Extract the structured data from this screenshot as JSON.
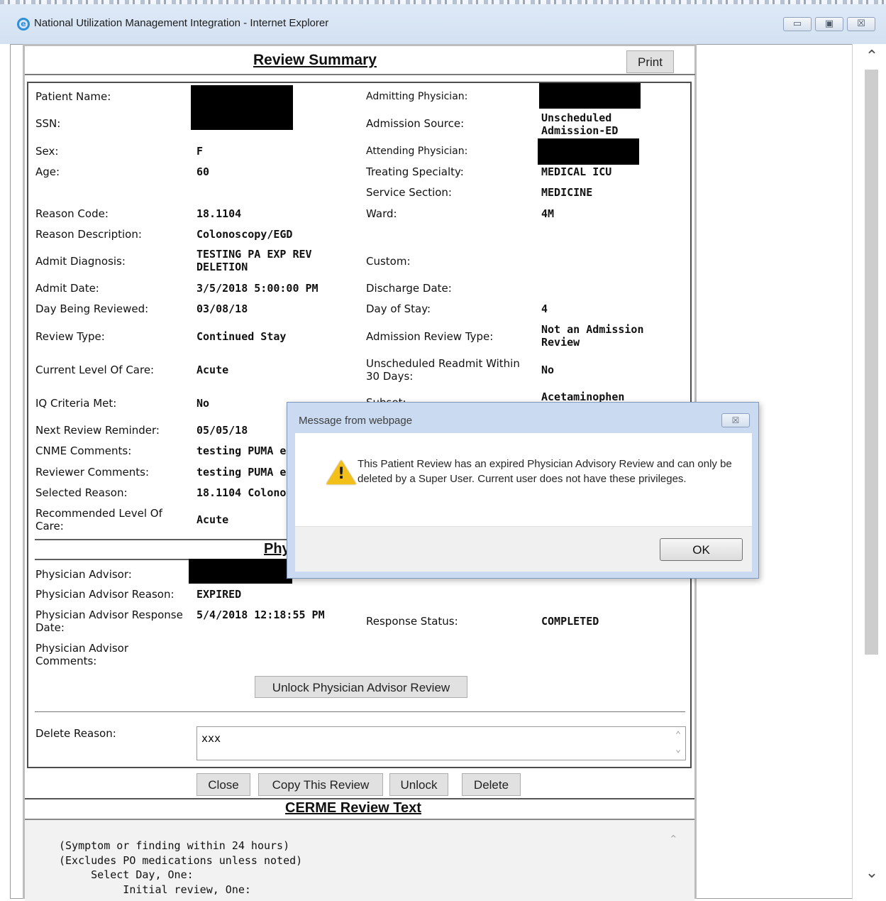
{
  "window": {
    "title": "National Utilization Management Integration - Internet Explorer",
    "minimize_symbol": "▭",
    "maximize_symbol": "▣",
    "close_symbol": "☒"
  },
  "summary": {
    "title": "Review Summary",
    "print_label": "Print"
  },
  "details": {
    "patient_name_label": "Patient Name:",
    "ssn_label": "SSN:",
    "sex_label": "Sex:",
    "sex_value": "F",
    "age_label": "Age:",
    "age_value": "60",
    "reason_code_label": "Reason Code:",
    "reason_code_value": "18.1104",
    "reason_description_label": "Reason Description:",
    "reason_description_value": "Colonoscopy/EGD",
    "admit_diagnosis_label": "Admit Diagnosis:",
    "admit_diagnosis_value": "TESTING PA EXP REV DELETION",
    "admit_date_label": "Admit Date:",
    "admit_date_value": "3/5/2018 5:00:00 PM",
    "day_being_reviewed_label": "Day Being Reviewed:",
    "day_being_reviewed_value": "03/08/18",
    "review_type_label": "Review Type:",
    "review_type_value": "Continued Stay",
    "current_level_label": "Current Level Of Care:",
    "current_level_value": "Acute",
    "iq_criteria_label": "IQ Criteria Met:",
    "iq_criteria_value": "No",
    "next_review_label": "Next Review Reminder:",
    "next_review_value": "05/05/18",
    "cnme_comments_label": "CNME Comments:",
    "cnme_comments_value": "testing PUMA e:",
    "reviewer_comments_label": "Reviewer Comments:",
    "reviewer_comments_value": "testing PUMA e:",
    "selected_reason_label": "Selected Reason:",
    "selected_reason_value": "18.1104 Colono",
    "recommended_level_label": "Recommended Level Of Care:",
    "recommended_level_value": "Acute",
    "admitting_physician_label": "Admitting Physician:",
    "admission_source_label": "Admission Source:",
    "admission_source_value": "Unscheduled Admission-ED",
    "attending_physician_label": "Attending Physician:",
    "treating_specialty_label": "Treating Specialty:",
    "treating_specialty_value": "MEDICAL ICU",
    "service_section_label": "Service Section:",
    "service_section_value": "MEDICINE",
    "ward_label": "Ward:",
    "ward_value": "4M",
    "custom_label": "Custom:",
    "discharge_date_label": "Discharge Date:",
    "day_of_stay_label": "Day of Stay:",
    "day_of_stay_value": "4",
    "admission_review_type_label": "Admission Review Type:",
    "admission_review_type_value": "Not an Admission Review",
    "readmit_label": "Unscheduled Readmit Within 30 Days:",
    "readmit_value": "No",
    "subset_label": "Subset:",
    "subset_value": "Acetaminophen"
  },
  "physician_section": {
    "title_partial": "Phy",
    "advisor_label": "Physician Advisor:",
    "advisor_reason_label": "Physician Advisor Reason:",
    "advisor_reason_value": "EXPIRED",
    "response_date_label": "Physician Advisor Response Date:",
    "response_date_value": "5/4/2018 12:18:55 PM",
    "response_status_label": "Response Status:",
    "response_status_value": "COMPLETED",
    "advisor_comments_label": "Physician Advisor Comments:",
    "unlock_advisor_label": "Unlock Physician Advisor Review"
  },
  "delete": {
    "reason_label": "Delete Reason:",
    "reason_value": "xxx"
  },
  "actions": {
    "close_label": "Close",
    "copy_label": "Copy This Review",
    "unlock_label": "Unlock",
    "delete_label": "Delete"
  },
  "cerme": {
    "title": "CERME Review Text",
    "text": "(Symptom or finding within 24 hours)\n(Excludes PO medications unless noted)\n     Select Day, One:\n          Initial review, One:"
  },
  "dialog": {
    "title": "Message from webpage",
    "close_symbol": "☒",
    "message": "This Patient Review has an expired Physician Advisory Review and can only be deleted by a Super User. Current user does not have these privileges.",
    "ok_label": "OK",
    "icon": "warning-icon"
  },
  "colors": {
    "dialog_background": "#c9daf1",
    "warning": "#f3bf19"
  }
}
